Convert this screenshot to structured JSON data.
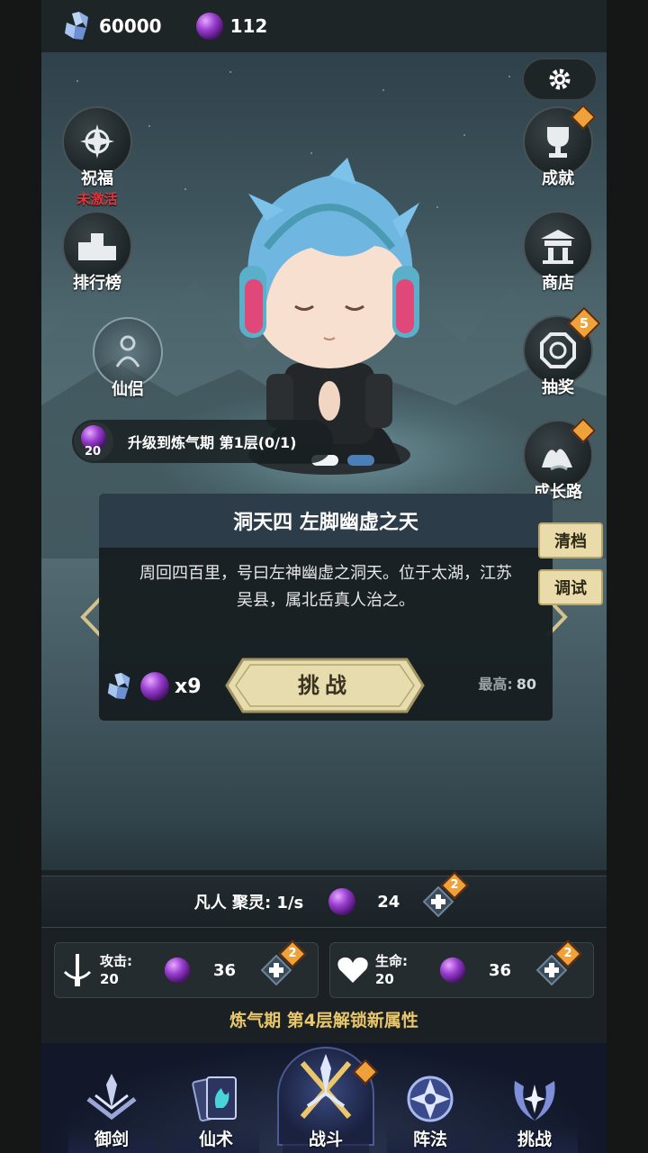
{
  "topbar": {
    "crystal_amount": "60000",
    "orb_amount": "112"
  },
  "left_buttons": {
    "blessing": {
      "label": "祝福",
      "status": "未激活"
    },
    "ranking": {
      "label": "排行榜"
    },
    "companion": {
      "label": "仙侣"
    }
  },
  "right_buttons": {
    "achievement": {
      "label": "成就"
    },
    "shop": {
      "label": "商店"
    },
    "lottery": {
      "label": "抽奖",
      "badge": "5"
    },
    "growth": {
      "label": "成长路"
    }
  },
  "upgrade": {
    "orb_count": "20",
    "text": "升级到炼气期 第1层(0/1)"
  },
  "stage": {
    "title": "洞天四 左脚幽虚之天",
    "description": "周回四百里，号曰左神幽虚之洞天。位于太湖，江苏吴县，属北岳真人治之。",
    "cost_multiplier": "x9",
    "challenge_label": "挑战",
    "best_label": "最高:",
    "best_value": "80"
  },
  "side_tags": {
    "clear": "清档",
    "debug": "调试"
  },
  "spirit": {
    "text": "凡人 聚灵: 1/s",
    "cost": "24",
    "badge": "2"
  },
  "stats": {
    "attack": {
      "name": "攻击:",
      "value": "20",
      "cost": "36",
      "badge": "2"
    },
    "life": {
      "name": "生命:",
      "value": "20",
      "cost": "36",
      "badge": "2"
    }
  },
  "unlock_text": "炼气期 第4层解锁新属性",
  "tabs": [
    {
      "label": "御剑"
    },
    {
      "label": "仙术"
    },
    {
      "label": "战斗"
    },
    {
      "label": "阵法"
    },
    {
      "label": "挑战"
    }
  ],
  "colors": {
    "accent_gold": "#e9c76a",
    "badge_orange": "#f0a23a",
    "inactive_red": "#e0343a",
    "orb_purple": "#9a3fd0"
  }
}
